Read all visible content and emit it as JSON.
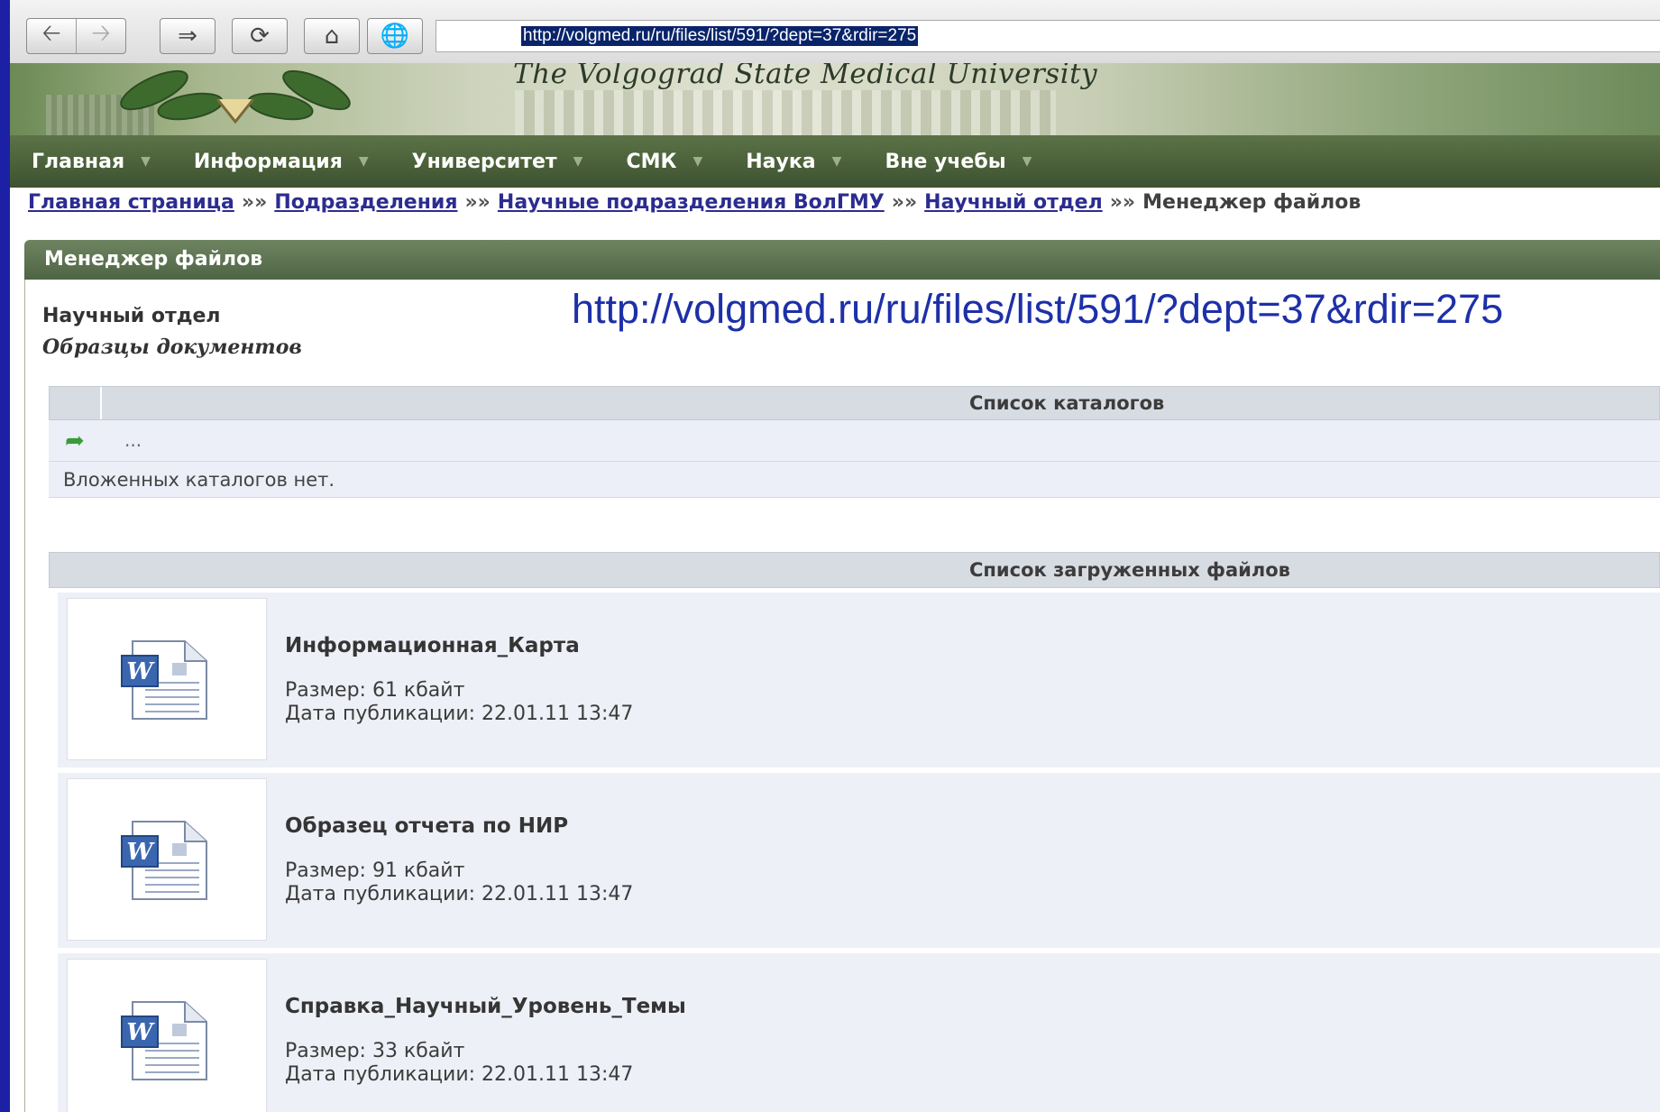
{
  "toolbar": {
    "address": "http://volgmed.ru/ru/files/list/591/?dept=37&rdir=275"
  },
  "header": {
    "university_name": "The Volgograd State Medical University"
  },
  "nav": {
    "items": [
      {
        "label": "Главная"
      },
      {
        "label": "Информация"
      },
      {
        "label": "Университет"
      },
      {
        "label": "СМК"
      },
      {
        "label": "Наука"
      },
      {
        "label": "Вне учебы"
      }
    ]
  },
  "breadcrumb": {
    "items": [
      {
        "label": "Главная страница"
      },
      {
        "label": "Подразделения"
      },
      {
        "label": "Научные подразделения ВолГМУ"
      },
      {
        "label": "Научный отдел"
      }
    ],
    "separator": "»»",
    "current": "Менеджер файлов"
  },
  "panel": {
    "title": "Менеджер файлов",
    "department": "Научный отдел",
    "subtitle": "Образцы документов"
  },
  "overlay": {
    "url": "http://volgmed.ru/ru/files/list/591/?dept=37&rdir=275"
  },
  "catalogs": {
    "header": "Список каталогов",
    "up_label": "...",
    "empty_text": "Вложенных каталогов нет."
  },
  "files": {
    "header": "Список загруженных файлов",
    "items": [
      {
        "name": "Информационная_Карта",
        "size": "Размер: 61 кбайт",
        "date": "Дата публикации: 22.01.11 13:47"
      },
      {
        "name": "Образец отчета по НИР",
        "size": "Размер: 91 кбайт",
        "date": "Дата публикации: 22.01.11 13:47"
      },
      {
        "name": "Справка_Научный_Уровень_Темы",
        "size": "Размер: 33 кбайт",
        "date": "Дата публикации: 22.01.11 13:47"
      }
    ]
  },
  "colors": {
    "slide_border": "#1c20a4",
    "nav_bg": "#4a5f3b",
    "link": "#2c2c90",
    "overlay_text": "#1d30a8"
  }
}
